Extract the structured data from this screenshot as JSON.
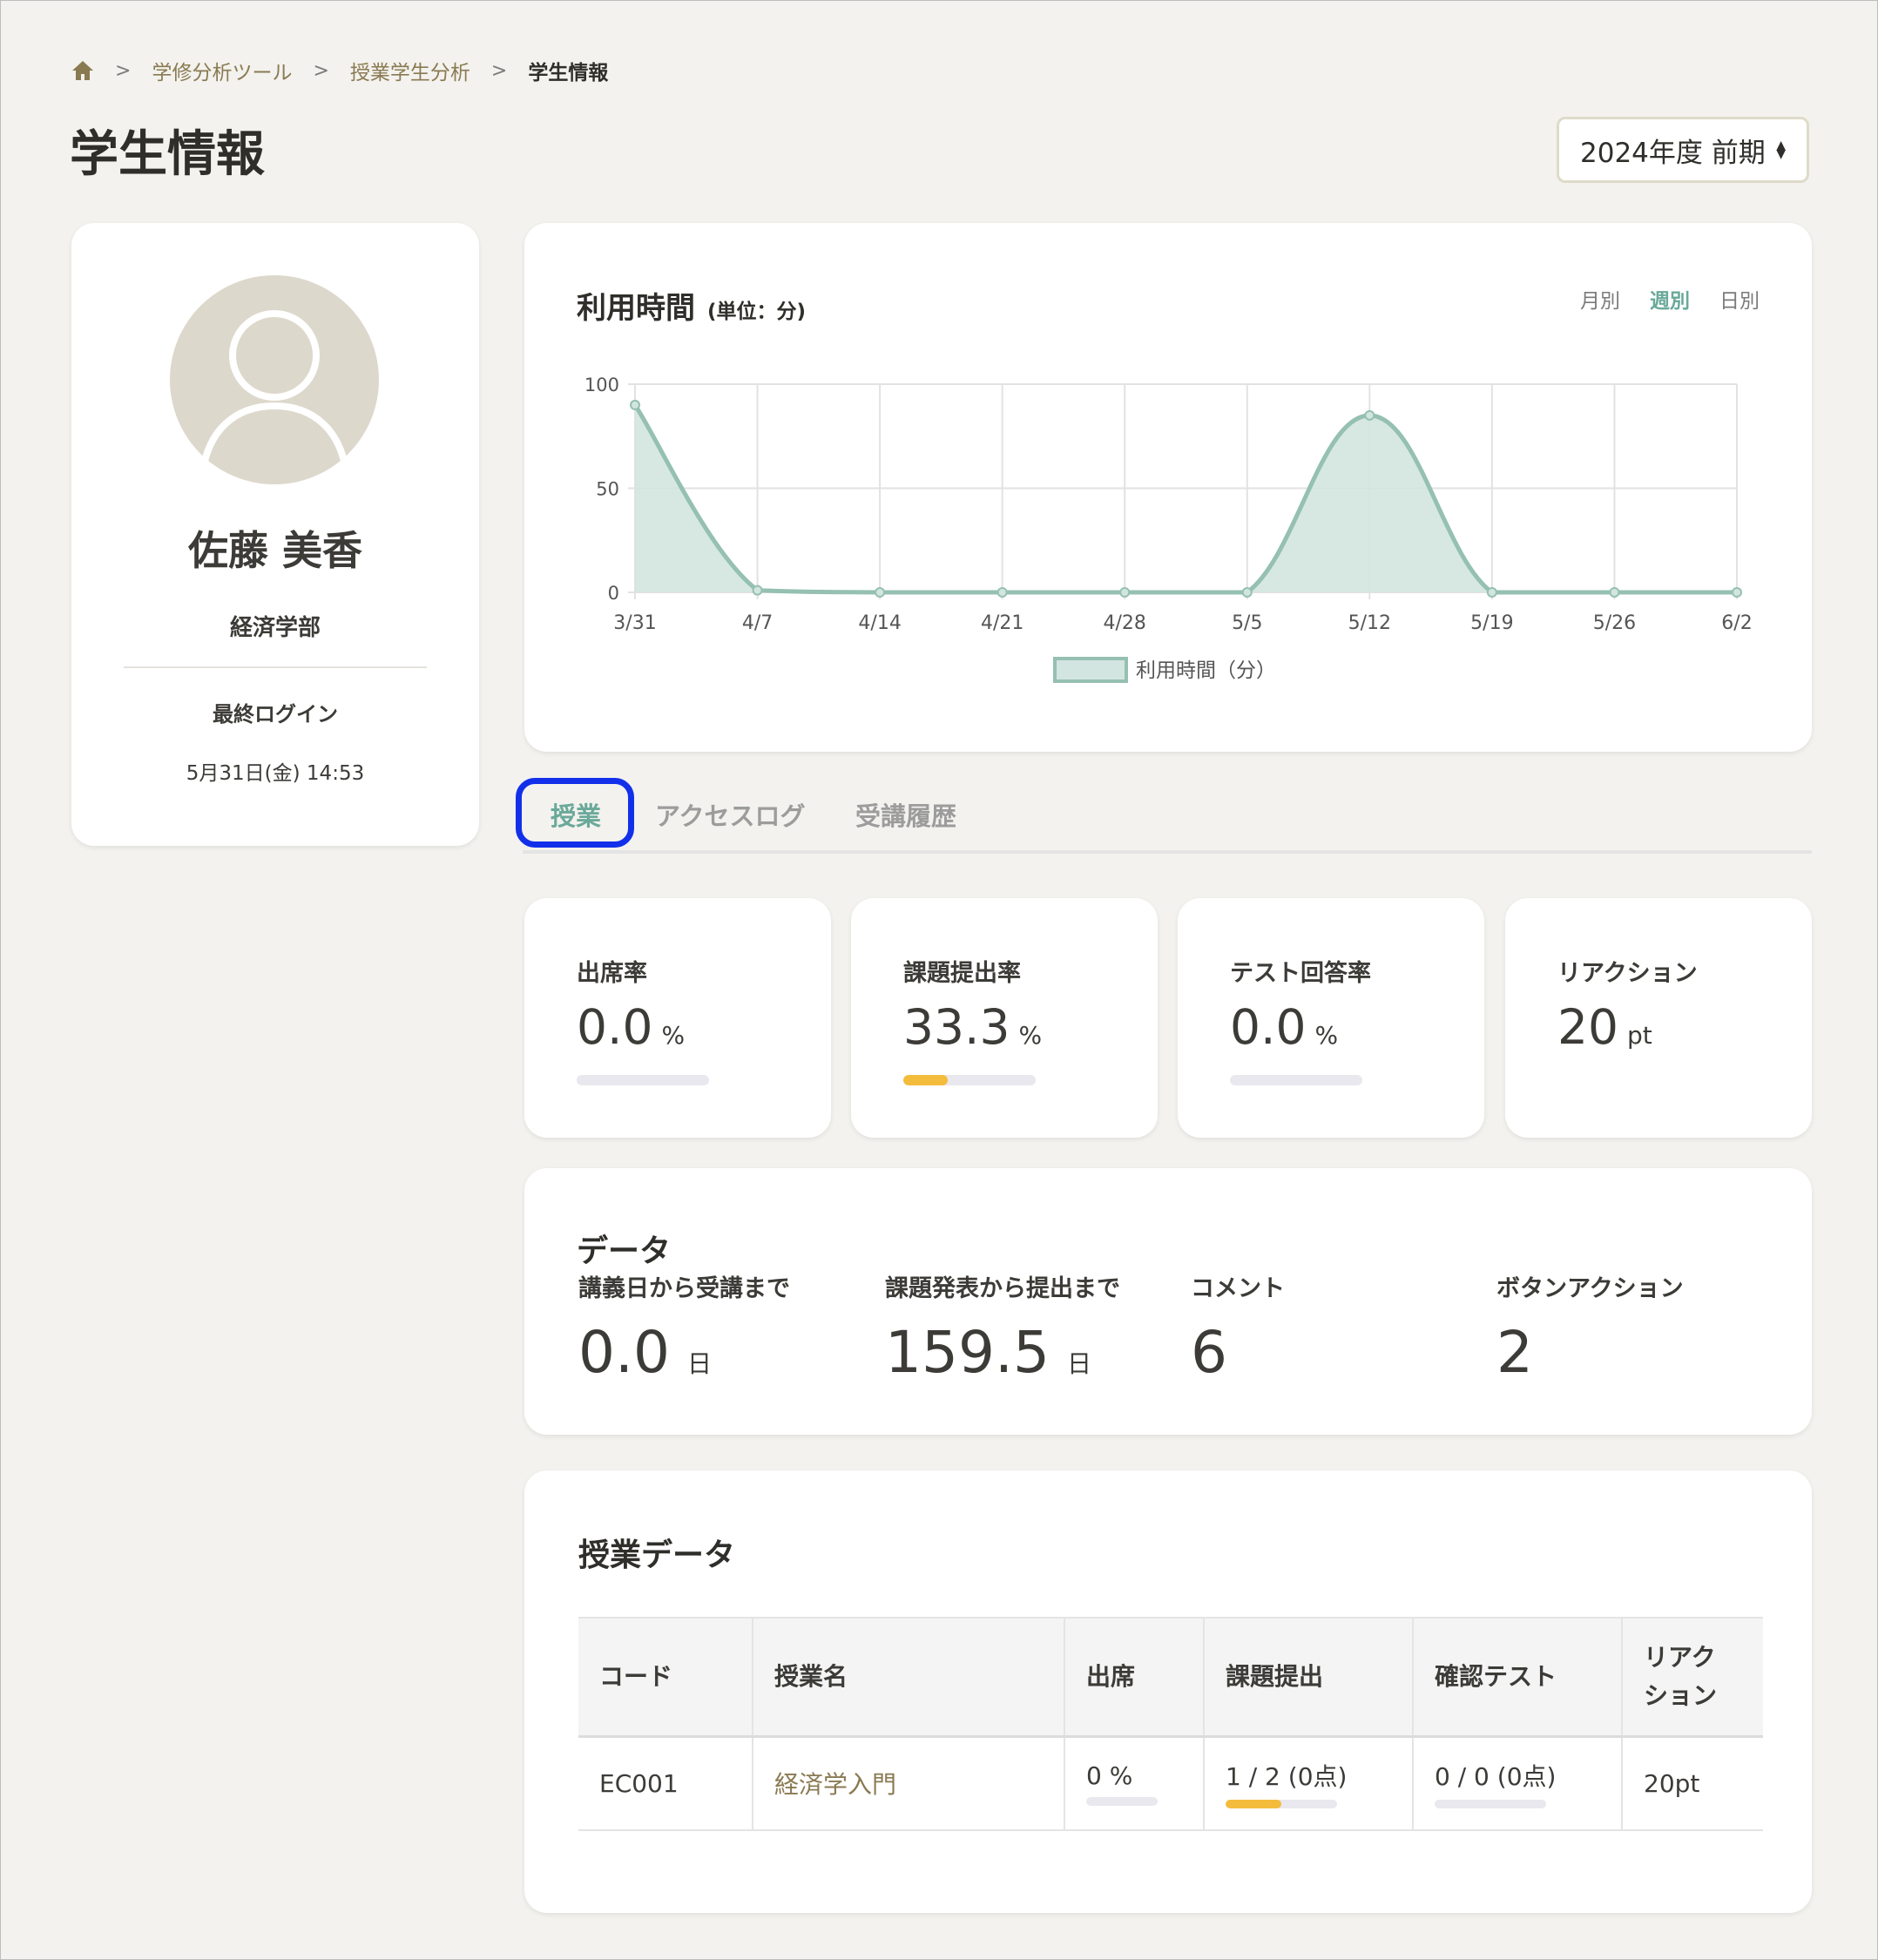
{
  "breadcrumb": {
    "home_icon": "home-icon",
    "items": [
      "学修分析ツール",
      "授業学生分析"
    ],
    "current": "学生情報",
    "separator": ">"
  },
  "page_title": "学生情報",
  "term_select": {
    "value": "2024年度 前期",
    "icon": "updown-icon"
  },
  "profile": {
    "name": "佐藤 美香",
    "faculty": "経済学部",
    "last_login_label": "最終ログイン",
    "last_login_value": "5月31日(金) 14:53",
    "avatar_icon": "user-avatar-icon"
  },
  "usage_chart": {
    "title": "利用時間",
    "unit": "(単位：分)",
    "range_tabs": [
      "月別",
      "週別",
      "日別"
    ],
    "active_range": "週別",
    "legend": "利用時間（分）"
  },
  "chart_data": {
    "type": "area",
    "x": [
      "3/31",
      "4/7",
      "4/14",
      "4/21",
      "4/28",
      "5/5",
      "5/12",
      "5/19",
      "5/26",
      "6/2"
    ],
    "series": [
      {
        "name": "利用時間（分）",
        "values": [
          90,
          1,
          0,
          0,
          0,
          0,
          85,
          0,
          0,
          0
        ]
      }
    ],
    "yticks": [
      0,
      50,
      100
    ],
    "ylim": [
      0,
      100
    ],
    "grid": true,
    "legend_position": "bottom",
    "colors": {
      "line": "#95c0b2",
      "fill": "#d3e5e0"
    }
  },
  "tabs": [
    "授業",
    "アクセスログ",
    "受講履歴"
  ],
  "active_tab": "授業",
  "metrics": [
    {
      "label": "出席率",
      "value": "0.0",
      "unit": "%",
      "progress": 0
    },
    {
      "label": "課題提出率",
      "value": "33.3",
      "unit": "%",
      "progress": 0.333
    },
    {
      "label": "テスト回答率",
      "value": "0.0",
      "unit": "%",
      "progress": 0
    },
    {
      "label": "リアクション",
      "value": "20",
      "unit": "pt"
    }
  ],
  "data_section": {
    "title": "データ",
    "stats": [
      {
        "label": "講義日から受講まで",
        "value": "0.0",
        "unit": "日"
      },
      {
        "label": "課題発表から提出まで",
        "value": "159.5",
        "unit": "日"
      },
      {
        "label": "コメント",
        "value": "6",
        "unit": ""
      },
      {
        "label": "ボタンアクション",
        "value": "2",
        "unit": ""
      }
    ]
  },
  "course_table": {
    "title": "授業データ",
    "headers": [
      "コード",
      "授業名",
      "出席",
      "課題提出",
      "確認テスト",
      "リアク\nション"
    ],
    "rows": [
      {
        "code": "EC001",
        "name": "経済学入門",
        "attendance": "0 %",
        "attendance_progress": 0,
        "assignment": "1 / 2 (0点)",
        "assignment_progress": 0.5,
        "test": "0 / 0 (0点)",
        "test_progress": 0,
        "reaction": "20pt"
      }
    ]
  },
  "colors": {
    "accent": "#6aa99a",
    "brand_text": "#8a7a52",
    "progress": "#f4bc3c",
    "focus_ring": "#1230ea",
    "background": "#f3f2ee"
  }
}
